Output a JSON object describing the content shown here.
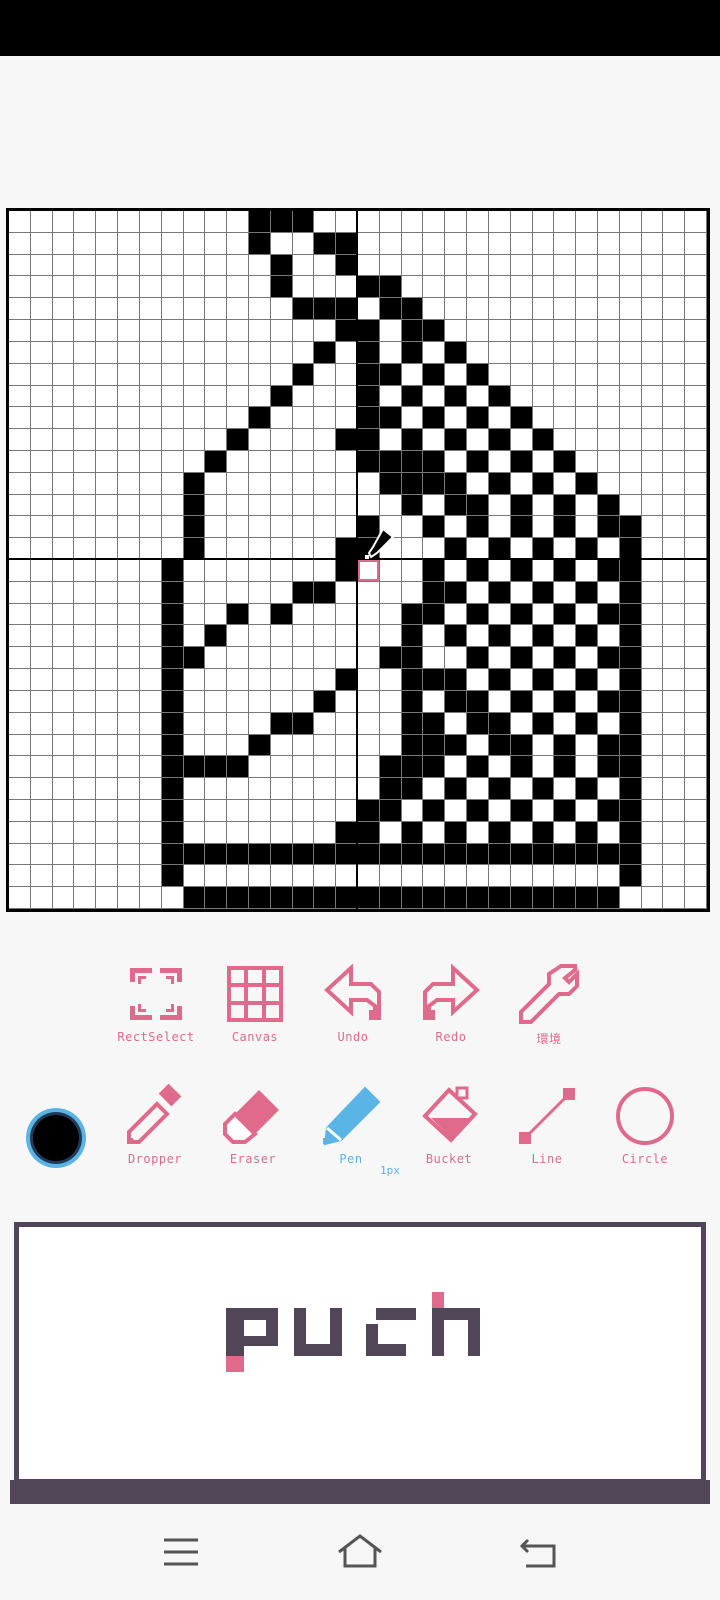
{
  "status_bar": {},
  "canvas": {
    "columns": 32,
    "rows": 32,
    "pixels": [
      "00000000000111000000000000000000",
      "00000000000100110000000000000000",
      "00000000000010010000000000000000",
      "00000000000010001100000000000000",
      "00000000000001110110000000000000",
      "00000000000000011011000000000000",
      "00000000000000101010100000000000",
      "00000000000001001101010000000000",
      "00000000000010001010101000000000",
      "00000000000100001101010100000000",
      "00000000001000011010101010000000",
      "00000000010000001111010101000000",
      "00000000100000000111101010100000",
      "00000000100000000010110101010000",
      "00000000100000001001010101011000",
      "00000000100000011000101010101000",
      "00000001000000010001010101011000",
      "00000001000001100001101010101000",
      "00000001001010000011010101011000",
      "00000001010000000010101010101000",
      "00000001100000000110010101011000",
      "00000001000000010011101010101000",
      "00000001000000100010110101011000",
      "00000001000011000011011010101000",
      "00000001000100000011101101011000",
      "00000001111000000111010101011000",
      "00000001000000000110101010101000",
      "00000001000000001101010101011000",
      "00000001000000011010101010101000",
      "00000001111111111111111111111000",
      "00000001000000000000000000001000",
      "00000000111111111111111111110000"
    ]
  },
  "toolbar_top": {
    "items": [
      {
        "label": "RectSelect",
        "icon": "rect-select-icon"
      },
      {
        "label": "Canvas",
        "icon": "grid-icon"
      },
      {
        "label": "Undo",
        "icon": "undo-arrow-icon"
      },
      {
        "label": "Redo",
        "icon": "redo-arrow-icon"
      },
      {
        "label": "環境",
        "icon": "wrench-icon"
      }
    ]
  },
  "toolbar_bottom": {
    "current_color": "#000000",
    "items": [
      {
        "label": "Dropper",
        "icon": "dropper-icon"
      },
      {
        "label": "Eraser",
        "icon": "eraser-icon"
      },
      {
        "label": "Pen",
        "icon": "pen-icon",
        "active": true
      },
      {
        "label": "Bucket",
        "icon": "bucket-icon"
      },
      {
        "label": "Line",
        "icon": "line-icon"
      },
      {
        "label": "Circle",
        "icon": "circle-icon"
      }
    ],
    "pen_size": "1px"
  },
  "push_button": {
    "label": "push"
  },
  "colors": {
    "accent_pink": "#e06a8c",
    "active_blue": "#5ab4e5",
    "push_dark": "#514558"
  },
  "nav_bar": {
    "items": [
      "menu-icon",
      "home-icon",
      "back-icon"
    ]
  }
}
